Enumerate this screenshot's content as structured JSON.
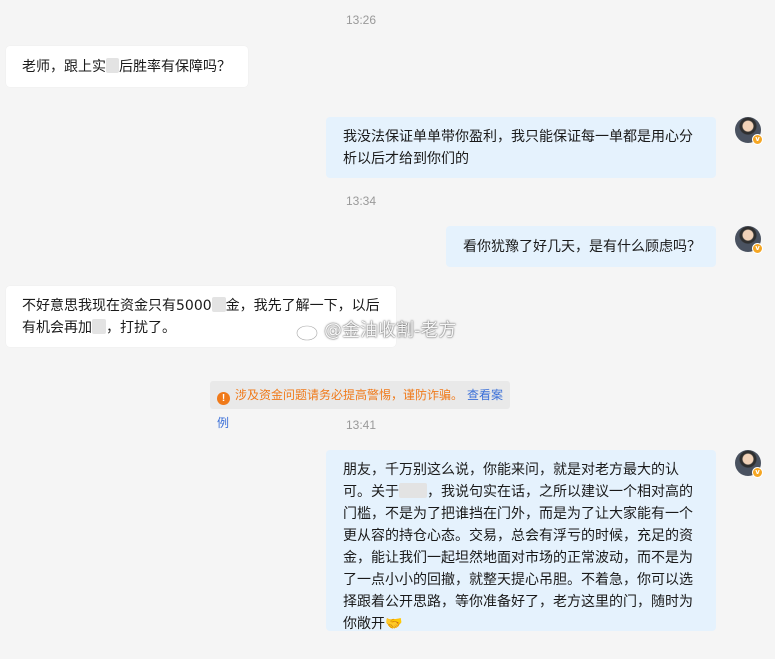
{
  "timestamps": [
    "13:26",
    "13:34",
    "13:41"
  ],
  "messages": [
    {
      "side": "left",
      "lines": [
        "老师，跟上实",
        "后胜率有保障吗？"
      ]
    },
    {
      "side": "right",
      "lines": [
        "我没法保证单单带你盈利，我只能保证每一单都是用心分",
        "析以后才给到你们的"
      ]
    },
    {
      "side": "right",
      "lines": [
        "看你犹豫了好几天，是有什么顾虑吗？"
      ]
    },
    {
      "side": "left",
      "lines": [
        "不好意思我现在资金只有5000",
        "金，我先了解一下，以后",
        "有机会再加",
        "，打扰了。"
      ]
    },
    {
      "side": "right",
      "lines": [
        "朋友，千万别这么说，你能来问，就是对老方最大的认",
        "可。关于",
        "，我说句实在话，之所以建议一个相对高的",
        "门槛，不是为了把谁挡在门外，而是为了让大家能有一个",
        "更从容的持仓心态。交易，总会有浮亏的时候，充足的资",
        "金，能让我们一起坦然地面对市场的正常波动，而不是为",
        "了一点小小的回撤，就整天提心吊胆。不着急，你可以选",
        "择跟着公开思路，等你准备好了，老方这里的门，随时为",
        "你敞开"
      ]
    }
  ],
  "notice": {
    "text": "涉及资金问题请务必提高警惕，谨防诈骗。",
    "link": "查看案例",
    "icon": "warning-icon",
    "color": "#f07a1a",
    "link_color": "#3a6fd8"
  },
  "watermark": {
    "text": "@金油收割-老方",
    "icon": "weibo-icon"
  },
  "emoji": {
    "handshake": "🤝"
  },
  "colors": {
    "background": "#f5f5f5",
    "bubble_left": "#ffffff",
    "bubble_right": "#e5f2fd"
  }
}
